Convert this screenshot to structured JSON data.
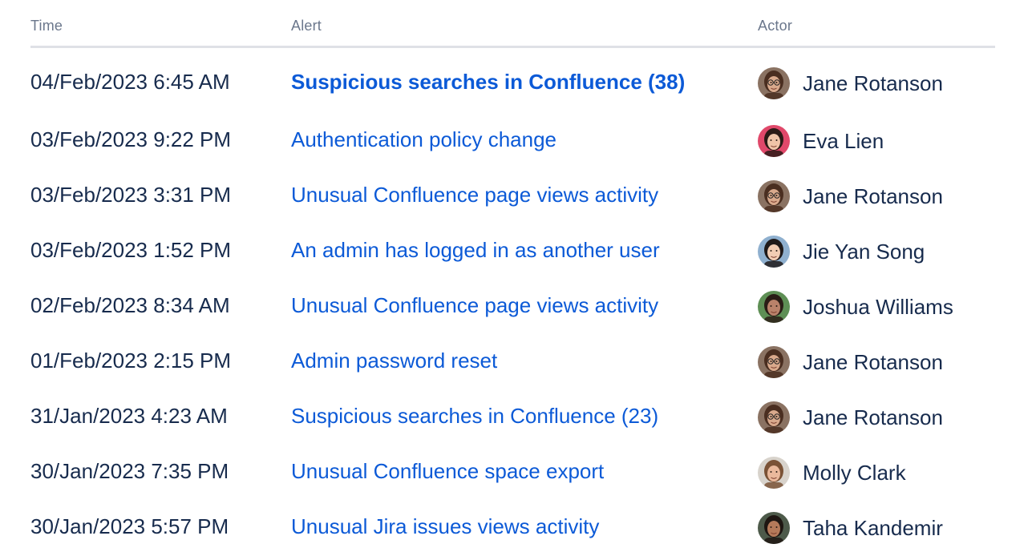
{
  "headers": {
    "time": "Time",
    "alert": "Alert",
    "actor": "Actor"
  },
  "rows": [
    {
      "time": "04/Feb/2023 6:45 AM",
      "alert": "Suspicious searches in Confluence (38)",
      "actor": "Jane Rotanson",
      "bold": true,
      "avatar": "avatar-jane"
    },
    {
      "time": "03/Feb/2023 9:22 PM",
      "alert": "Authentication policy change",
      "actor": "Eva Lien",
      "bold": false,
      "avatar": "avatar-eva"
    },
    {
      "time": "03/Feb/2023 3:31 PM",
      "alert": "Unusual Confluence page views activity",
      "actor": "Jane Rotanson",
      "bold": false,
      "avatar": "avatar-jane"
    },
    {
      "time": "03/Feb/2023 1:52 PM",
      "alert": "An admin has logged in as another user",
      "actor": "Jie Yan Song",
      "bold": false,
      "avatar": "avatar-jie"
    },
    {
      "time": "02/Feb/2023 8:34 AM",
      "alert": "Unusual Confluence page views activity",
      "actor": "Joshua Williams",
      "bold": false,
      "avatar": "avatar-joshua"
    },
    {
      "time": "01/Feb/2023 2:15 PM",
      "alert": "Admin password reset",
      "actor": "Jane Rotanson",
      "bold": false,
      "avatar": "avatar-jane"
    },
    {
      "time": "31/Jan/2023 4:23 AM",
      "alert": "Suspicious searches in Confluence (23)",
      "actor": "Jane Rotanson",
      "bold": false,
      "avatar": "avatar-jane"
    },
    {
      "time": "30/Jan/2023 7:35 PM",
      "alert": "Unusual Confluence space export",
      "actor": "Molly Clark",
      "bold": false,
      "avatar": "avatar-molly"
    },
    {
      "time": "30/Jan/2023 5:57 PM",
      "alert": "Unusual Jira issues views activity",
      "actor": "Taha Kandemir",
      "bold": false,
      "avatar": "avatar-taha"
    }
  ],
  "colors": {
    "link": "#0C5AD7",
    "text": "#172B4D",
    "header": "#6B778C",
    "divider": "#DFE1E6"
  }
}
